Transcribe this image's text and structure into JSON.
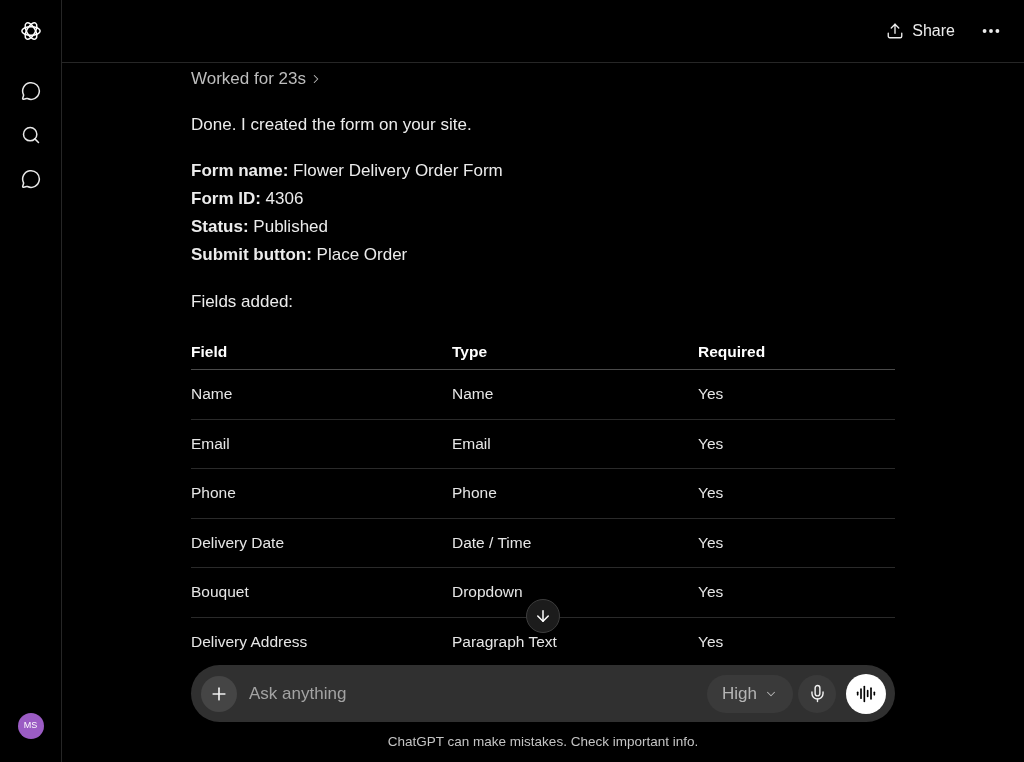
{
  "sidebar": {
    "avatar": {
      "initials": "MS"
    }
  },
  "header": {
    "share_label": "Share"
  },
  "message": {
    "worked_for": "Worked for 23s",
    "intro": "Done. I created the form on your site.",
    "details": [
      "**Form name:** Flower Delivery Order Form",
      "**Form ID:** 4306",
      "**Status:** Published",
      "**Submit button:** Place Order"
    ],
    "fields_heading": "Fields added:"
  },
  "table": {
    "columns": [
      "Field",
      "Type",
      "Required"
    ],
    "rows": [
      [
        "Name",
        "Name",
        "Yes"
      ],
      [
        "Email",
        "Email",
        "Yes"
      ],
      [
        "Phone",
        "Phone",
        "Yes"
      ],
      [
        "Delivery Date",
        "Date / Time",
        "Yes"
      ],
      [
        "Bouquet",
        "Dropdown",
        "Yes"
      ],
      [
        "Delivery Address",
        "Paragraph Text",
        "Yes"
      ]
    ]
  },
  "composer": {
    "placeholder": "Ask anything",
    "effort_option": "High"
  },
  "footer": "ChatGPT can make mistakes. Check important info."
}
